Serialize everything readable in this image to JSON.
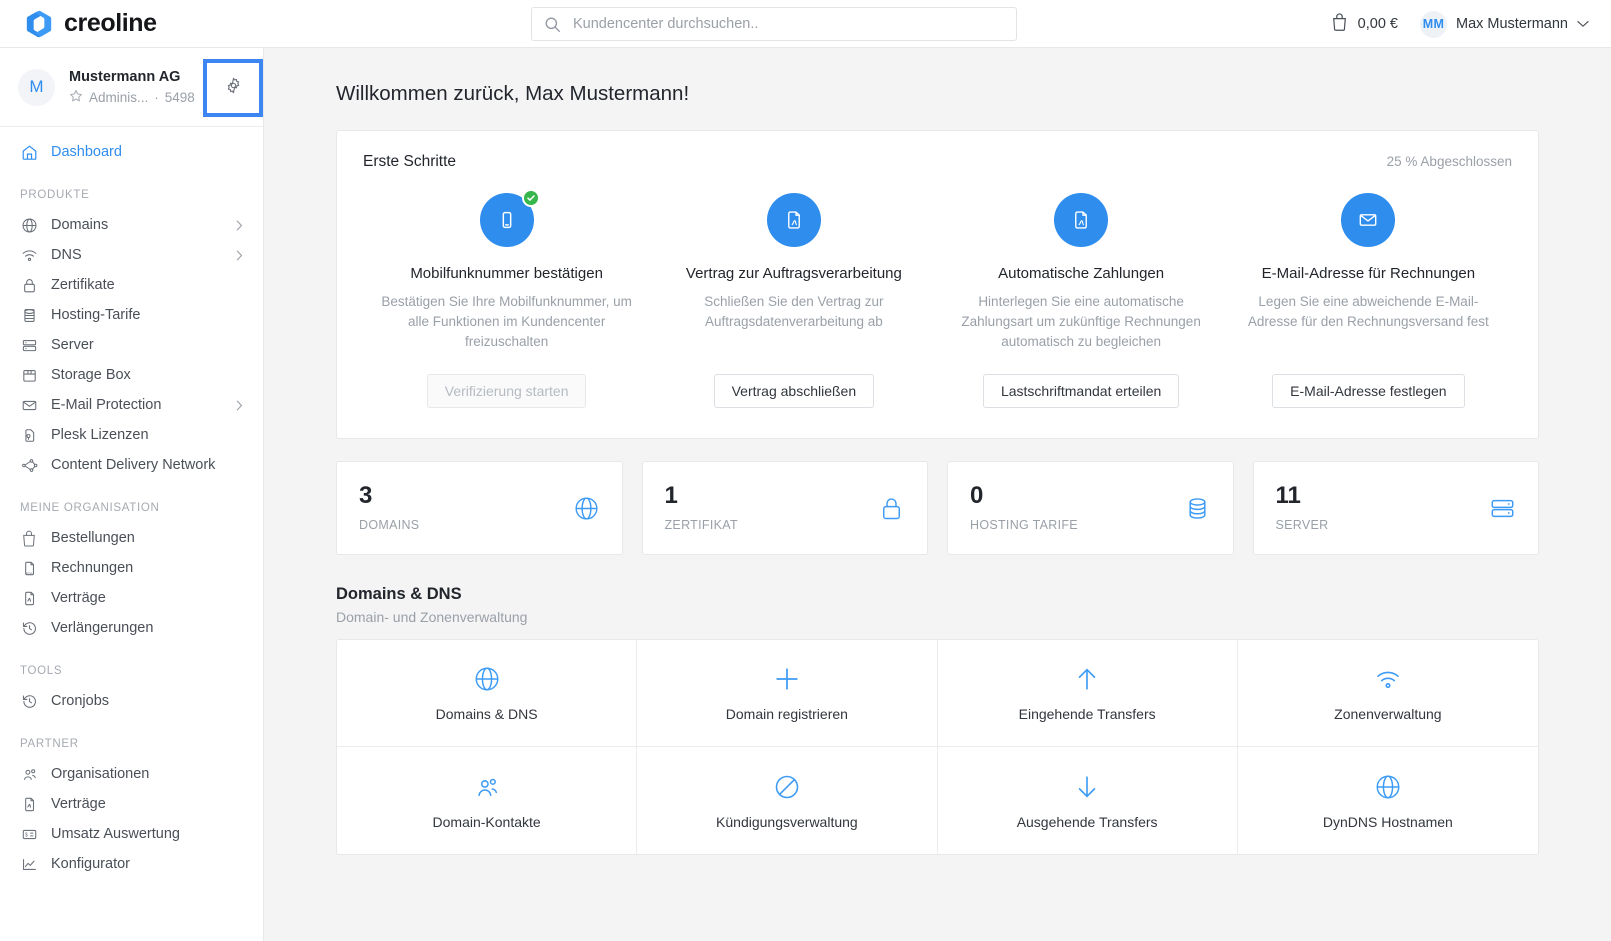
{
  "brand": {
    "name": "creoline",
    "accent": "#2f8ded",
    "logo_icon": "creoline-logo-icon"
  },
  "topbar": {
    "search": {
      "placeholder": "Kundencenter durchsuchen..",
      "value": "",
      "icon": "search-icon"
    },
    "cart": {
      "icon": "shopping-bag-icon",
      "amount": "0,00 €"
    },
    "user": {
      "initials": "MM",
      "name": "Max Mustermann",
      "chevron": "chevron-down-icon"
    }
  },
  "sidebar": {
    "org": {
      "avatar_letter": "M",
      "name": "Mustermann AG",
      "star_icon": "star-icon",
      "role": "Adminis...",
      "separator": "·",
      "customer_id": "5498",
      "settings_icon": "gear-icon"
    },
    "dashboard": {
      "label": "Dashboard",
      "icon": "home-icon"
    },
    "sections": [
      {
        "title": "PRODUKTE",
        "items": [
          {
            "label": "Domains",
            "icon": "globe-icon",
            "chevron": true
          },
          {
            "label": "DNS",
            "icon": "wifi-icon",
            "chevron": true
          },
          {
            "label": "Zertifikate",
            "icon": "lock-icon",
            "chevron": false
          },
          {
            "label": "Hosting-Tarife",
            "icon": "database-icon",
            "chevron": false
          },
          {
            "label": "Server",
            "icon": "server-icon",
            "chevron": false
          },
          {
            "label": "Storage Box",
            "icon": "box-icon",
            "chevron": false
          },
          {
            "label": "E-Mail Protection",
            "icon": "mail-icon",
            "chevron": true
          },
          {
            "label": "Plesk Lizenzen",
            "icon": "license-icon",
            "chevron": false
          },
          {
            "label": "Content Delivery Network",
            "icon": "network-icon",
            "chevron": false
          }
        ]
      },
      {
        "title": "MEINE ORGANISATION",
        "items": [
          {
            "label": "Bestellungen",
            "icon": "shopping-bag-icon",
            "chevron": false
          },
          {
            "label": "Rechnungen",
            "icon": "pdf-file-icon",
            "chevron": false
          },
          {
            "label": "Verträge",
            "icon": "contract-file-icon",
            "chevron": false
          },
          {
            "label": "Verlängerungen",
            "icon": "history-icon",
            "chevron": false
          }
        ]
      },
      {
        "title": "TOOLS",
        "items": [
          {
            "label": "Cronjobs",
            "icon": "history-icon",
            "chevron": false
          }
        ]
      },
      {
        "title": "PARTNER",
        "items": [
          {
            "label": "Organisationen",
            "icon": "users-icon",
            "chevron": false
          },
          {
            "label": "Verträge",
            "icon": "contract-file-icon",
            "chevron": false
          },
          {
            "label": "Umsatz Auswertung",
            "icon": "invoice-icon",
            "chevron": false
          },
          {
            "label": "Konfigurator",
            "icon": "line-chart-icon",
            "chevron": false
          }
        ]
      }
    ]
  },
  "main": {
    "page_title": "Willkommen zurück, Max Mustermann!",
    "onboarding": {
      "title": "Erste Schritte",
      "progress_label": "25 % Abgeschlossen",
      "progress_percent": 25,
      "steps": [
        {
          "icon": "mobile-phone-icon",
          "completed": true,
          "title": "Mobilfunknummer bestätigen",
          "description": "Bestätigen Sie Ihre Mobilfunknummer, um alle Funktionen im Kundencenter freizuschalten",
          "button": "Verifizierung starten",
          "button_disabled": true
        },
        {
          "icon": "pdf-file-icon",
          "completed": false,
          "title": "Vertrag zur Auftragsverarbeitung",
          "description": "Schließen Sie den Vertrag zur Auftragsdatenverarbeitung ab",
          "button": "Vertrag abschließen",
          "button_disabled": false
        },
        {
          "icon": "pdf-file-icon",
          "completed": false,
          "title": "Automatische Zahlungen",
          "description": "Hinterlegen Sie eine automatische Zahlungsart um zukünftige Rechnungen automatisch zu begleichen",
          "button": "Lastschriftmandat erteilen",
          "button_disabled": false
        },
        {
          "icon": "envelope-icon",
          "completed": false,
          "title": "E-Mail-Adresse für Rechnungen",
          "description": "Legen Sie eine abweichende E-Mail-Adresse für den Rechnungsversand fest",
          "button": "E-Mail-Adresse festlegen",
          "button_disabled": false
        }
      ]
    },
    "stats": [
      {
        "value": "3",
        "label": "DOMAINS",
        "icon": "globe-icon"
      },
      {
        "value": "1",
        "label": "ZERTIFIKAT",
        "icon": "lock-icon"
      },
      {
        "value": "0",
        "label": "HOSTING TARIFE",
        "icon": "database-icon"
      },
      {
        "value": "11",
        "label": "SERVER",
        "icon": "server-icon"
      }
    ],
    "domains_section": {
      "title": "Domains & DNS",
      "subtitle": "Domain- und Zonenverwaltung",
      "tiles": [
        {
          "label": "Domains & DNS",
          "icon": "globe-icon"
        },
        {
          "label": "Domain registrieren",
          "icon": "plus-icon"
        },
        {
          "label": "Eingehende Transfers",
          "icon": "arrow-up-icon"
        },
        {
          "label": "Zonenverwaltung",
          "icon": "wifi-icon"
        },
        {
          "label": "Domain-Kontakte",
          "icon": "users-icon"
        },
        {
          "label": "Kündigungsverwaltung",
          "icon": "ban-icon"
        },
        {
          "label": "Ausgehende Transfers",
          "icon": "arrow-down-icon"
        },
        {
          "label": "DynDNS Hostnamen",
          "icon": "globe-icon"
        }
      ]
    }
  }
}
